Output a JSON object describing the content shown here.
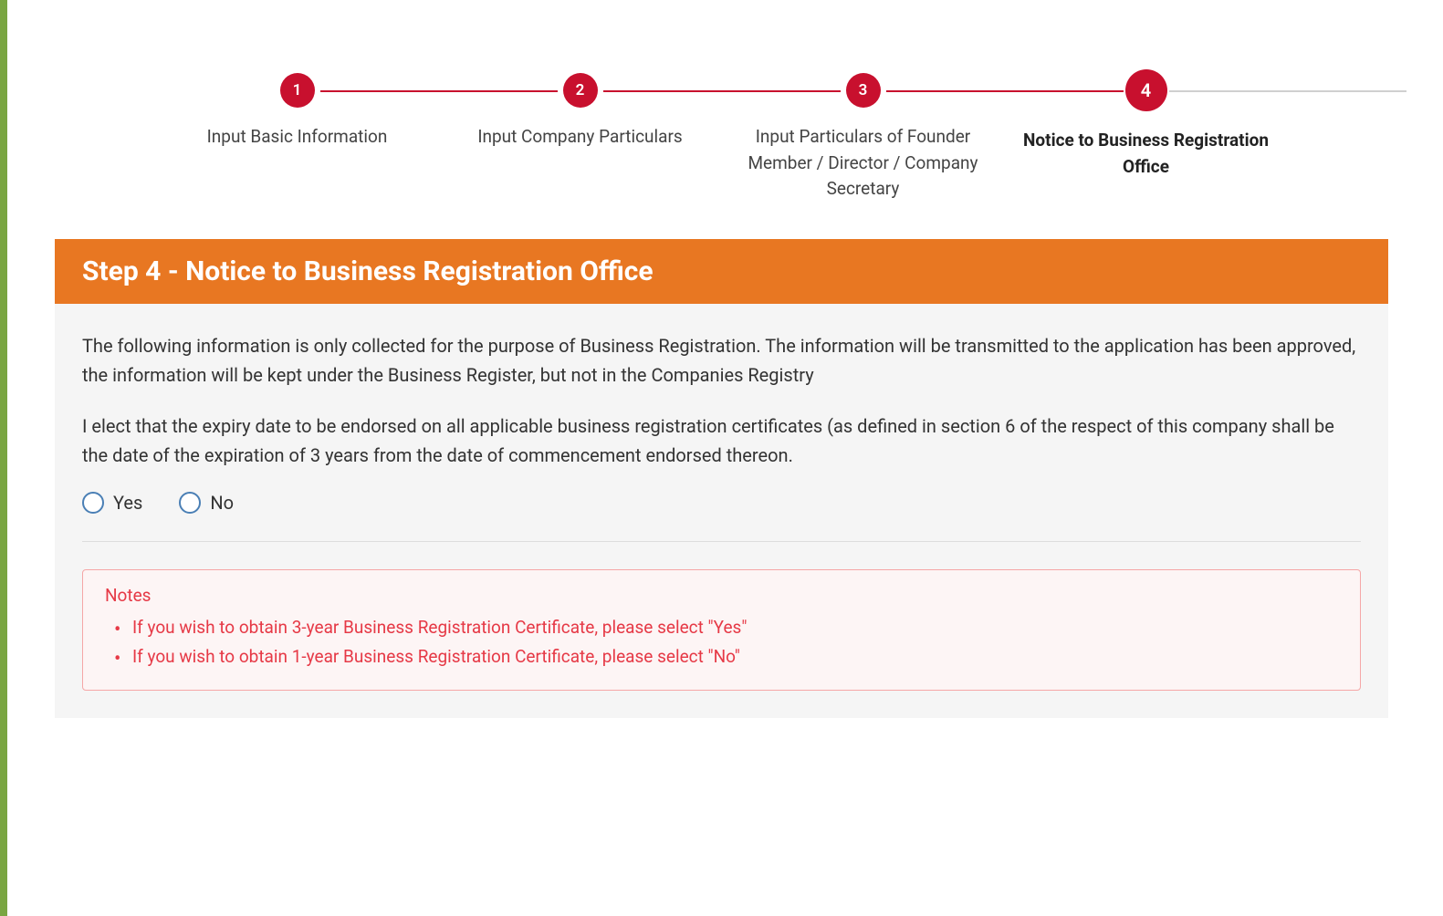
{
  "stepper": {
    "steps": [
      {
        "num": "1",
        "label": "Input Basic Information"
      },
      {
        "num": "2",
        "label": "Input Company Particulars"
      },
      {
        "num": "3",
        "label": "Input Particulars of Founder Member / Director / Company Secretary"
      },
      {
        "num": "4",
        "label": "Notice to Business Registration Office"
      }
    ],
    "activeIndex": 3
  },
  "panel": {
    "header": "Step 4 - Notice to Business Registration Office",
    "para1": "The following information is only collected for the purpose of Business Registration. The information will be transmitted to the application has been approved, the information will be kept under the Business Register, but not in the Companies Registry",
    "para2": "I elect that the expiry date to be endorsed on all applicable business registration certificates (as defined in section 6 of the respect of this company shall be the date of the expiration of 3 years from the date of commencement endorsed thereon."
  },
  "radio": {
    "yes": "Yes",
    "no": "No"
  },
  "notes": {
    "title": "Notes",
    "items": [
      "If you wish to obtain 3-year Business Registration Certificate, please select \"Yes\"",
      "If you wish to obtain 1-year Business Registration Certificate, please select \"No\""
    ]
  }
}
